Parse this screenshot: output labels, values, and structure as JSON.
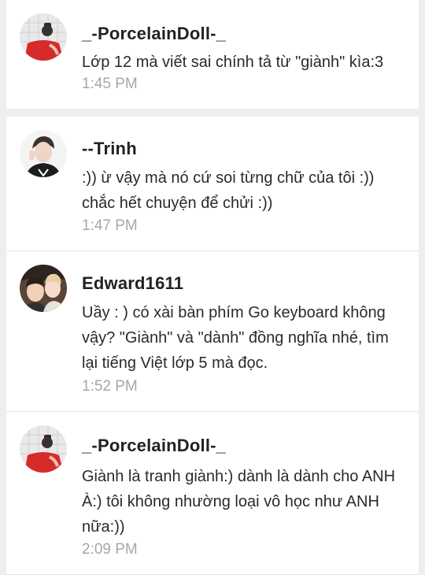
{
  "comments": [
    {
      "username": "_-PorcelainDoll-_",
      "text": "Lớp 12 mà viết sai chính tả từ \"giành\" kìa:3",
      "time": "1:45 PM",
      "avatar_icon": "user-avatar-girl-icon"
    },
    {
      "username": "--Trinh",
      "text": ":)) ừ vậy mà nó cứ soi từng chữ của tôi :)) chắc hết chuyện để chửi :))",
      "time": "1:47 PM",
      "avatar_icon": "user-avatar-boy-icon"
    },
    {
      "username": "Edward1611",
      "text": "Uầy : ) có xài bàn phím Go keyboard không vậy? \"Giành\" và \"dành\" đồng nghĩa nhé, tìm lại tiếng Việt lớp 5 mà đọc.",
      "time": "1:52 PM",
      "avatar_icon": "user-avatar-two-people-icon"
    },
    {
      "username": "_-PorcelainDoll-_",
      "text": "Giành là tranh giành:) dành là dành cho ANH À:) tôi không nhường loại vô học như ANH nữa:))",
      "time": "2:09 PM",
      "avatar_icon": "user-avatar-girl-icon"
    }
  ],
  "colors": {
    "background": "#eeeeee",
    "card": "#ffffff",
    "username": "#222222",
    "text": "#2a2a2a",
    "timestamp": "#a7a7a7"
  }
}
